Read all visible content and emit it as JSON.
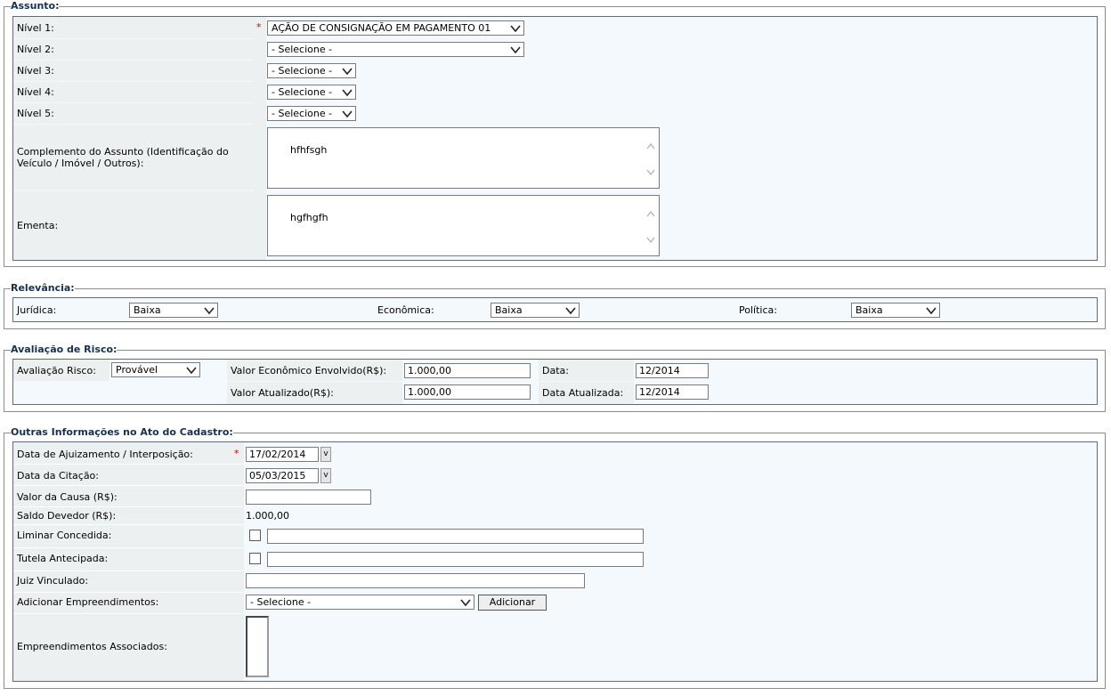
{
  "assunto": {
    "legend": "Assunto:",
    "required_mark": "*",
    "nivel1": {
      "label": "Nível 1:",
      "value": "AÇÃO DE CONSIGNAÇÃO EM PAGAMENTO 01"
    },
    "nivel2": {
      "label": "Nível 2:",
      "value": "- Selecione -"
    },
    "nivel3": {
      "label": "Nível 3:",
      "value": "- Selecione -"
    },
    "nivel4": {
      "label": "Nível 4:",
      "value": "- Selecione -"
    },
    "nivel5": {
      "label": "Nível 5:",
      "value": "- Selecione -"
    },
    "complemento": {
      "label": "Complemento do Assunto (Identificação do Veículo / Imóvel / Outros):",
      "value": "hfhfsgh"
    },
    "ementa": {
      "label": "Ementa:",
      "value": "hgfhgfh"
    }
  },
  "relevancia": {
    "legend": "Relevância:",
    "juridica": {
      "label": "Jurídica:",
      "value": "Baixa"
    },
    "economica": {
      "label": "Econômica:",
      "value": "Baixa"
    },
    "politica": {
      "label": "Política:",
      "value": "Baixa"
    }
  },
  "risco": {
    "legend": "Avaliação de Risco:",
    "avaliacao": {
      "label": "Avaliação Risco:",
      "value": "Provável"
    },
    "valor_economico": {
      "label": "Valor Econômico Envolvido(R$):",
      "value": "1.000,00"
    },
    "valor_atualizado": {
      "label": "Valor Atualizado(R$):",
      "value": "1.000,00"
    },
    "data": {
      "label": "Data:",
      "value": "12/2014"
    },
    "data_atualizada": {
      "label": "Data Atualizada:",
      "value": "12/2014"
    }
  },
  "outras": {
    "legend": "Outras Informações no Ato do Cadastro:",
    "required_mark": "*",
    "data_ajuizamento": {
      "label": "Data de Ajuizamento / Interposição:",
      "value": "17/02/2014",
      "picker": "v"
    },
    "data_citacao": {
      "label": "Data da Citação:",
      "value": "05/03/2015",
      "picker": "v"
    },
    "valor_causa": {
      "label": "Valor da Causa (R$):",
      "value": ""
    },
    "saldo_devedor": {
      "label": "Saldo Devedor (R$):",
      "value": "1.000,00"
    },
    "liminar": {
      "label": "Liminar Concedida:",
      "checked": false,
      "value": ""
    },
    "tutela": {
      "label": "Tutela Antecipada:",
      "checked": false,
      "value": ""
    },
    "juiz": {
      "label": "Juiz Vinculado:",
      "value": ""
    },
    "empreendimentos": {
      "label": "Adicionar Empreendimentos:",
      "value": "- Selecione -",
      "button": "Adicionar"
    },
    "associados": {
      "label": "Empreendimentos Associados:"
    }
  },
  "icons": {
    "chevron": "chevron-down-icon",
    "scroll_up": "scroll-up-icon",
    "scroll_down": "scroll-down-icon"
  },
  "colors": {
    "legend": "#16304f",
    "panel_bg": "#f3f9fd",
    "label_bg": "#edf0f1",
    "required": "#cc0000"
  }
}
